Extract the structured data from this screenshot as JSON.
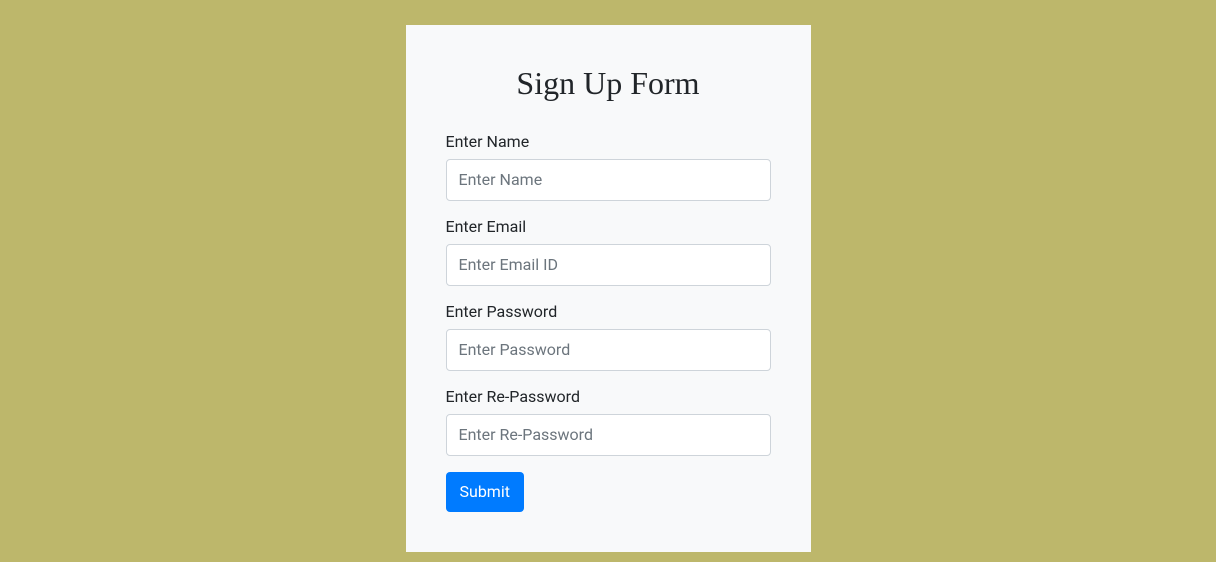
{
  "form": {
    "title": "Sign Up Form",
    "fields": {
      "name": {
        "label": "Enter Name",
        "placeholder": "Enter Name"
      },
      "email": {
        "label": "Enter Email",
        "placeholder": "Enter Email ID"
      },
      "password": {
        "label": "Enter Password",
        "placeholder": "Enter Password"
      },
      "repassword": {
        "label": "Enter Re-Password",
        "placeholder": "Enter Re-Password"
      }
    },
    "submit_label": "Submit"
  }
}
